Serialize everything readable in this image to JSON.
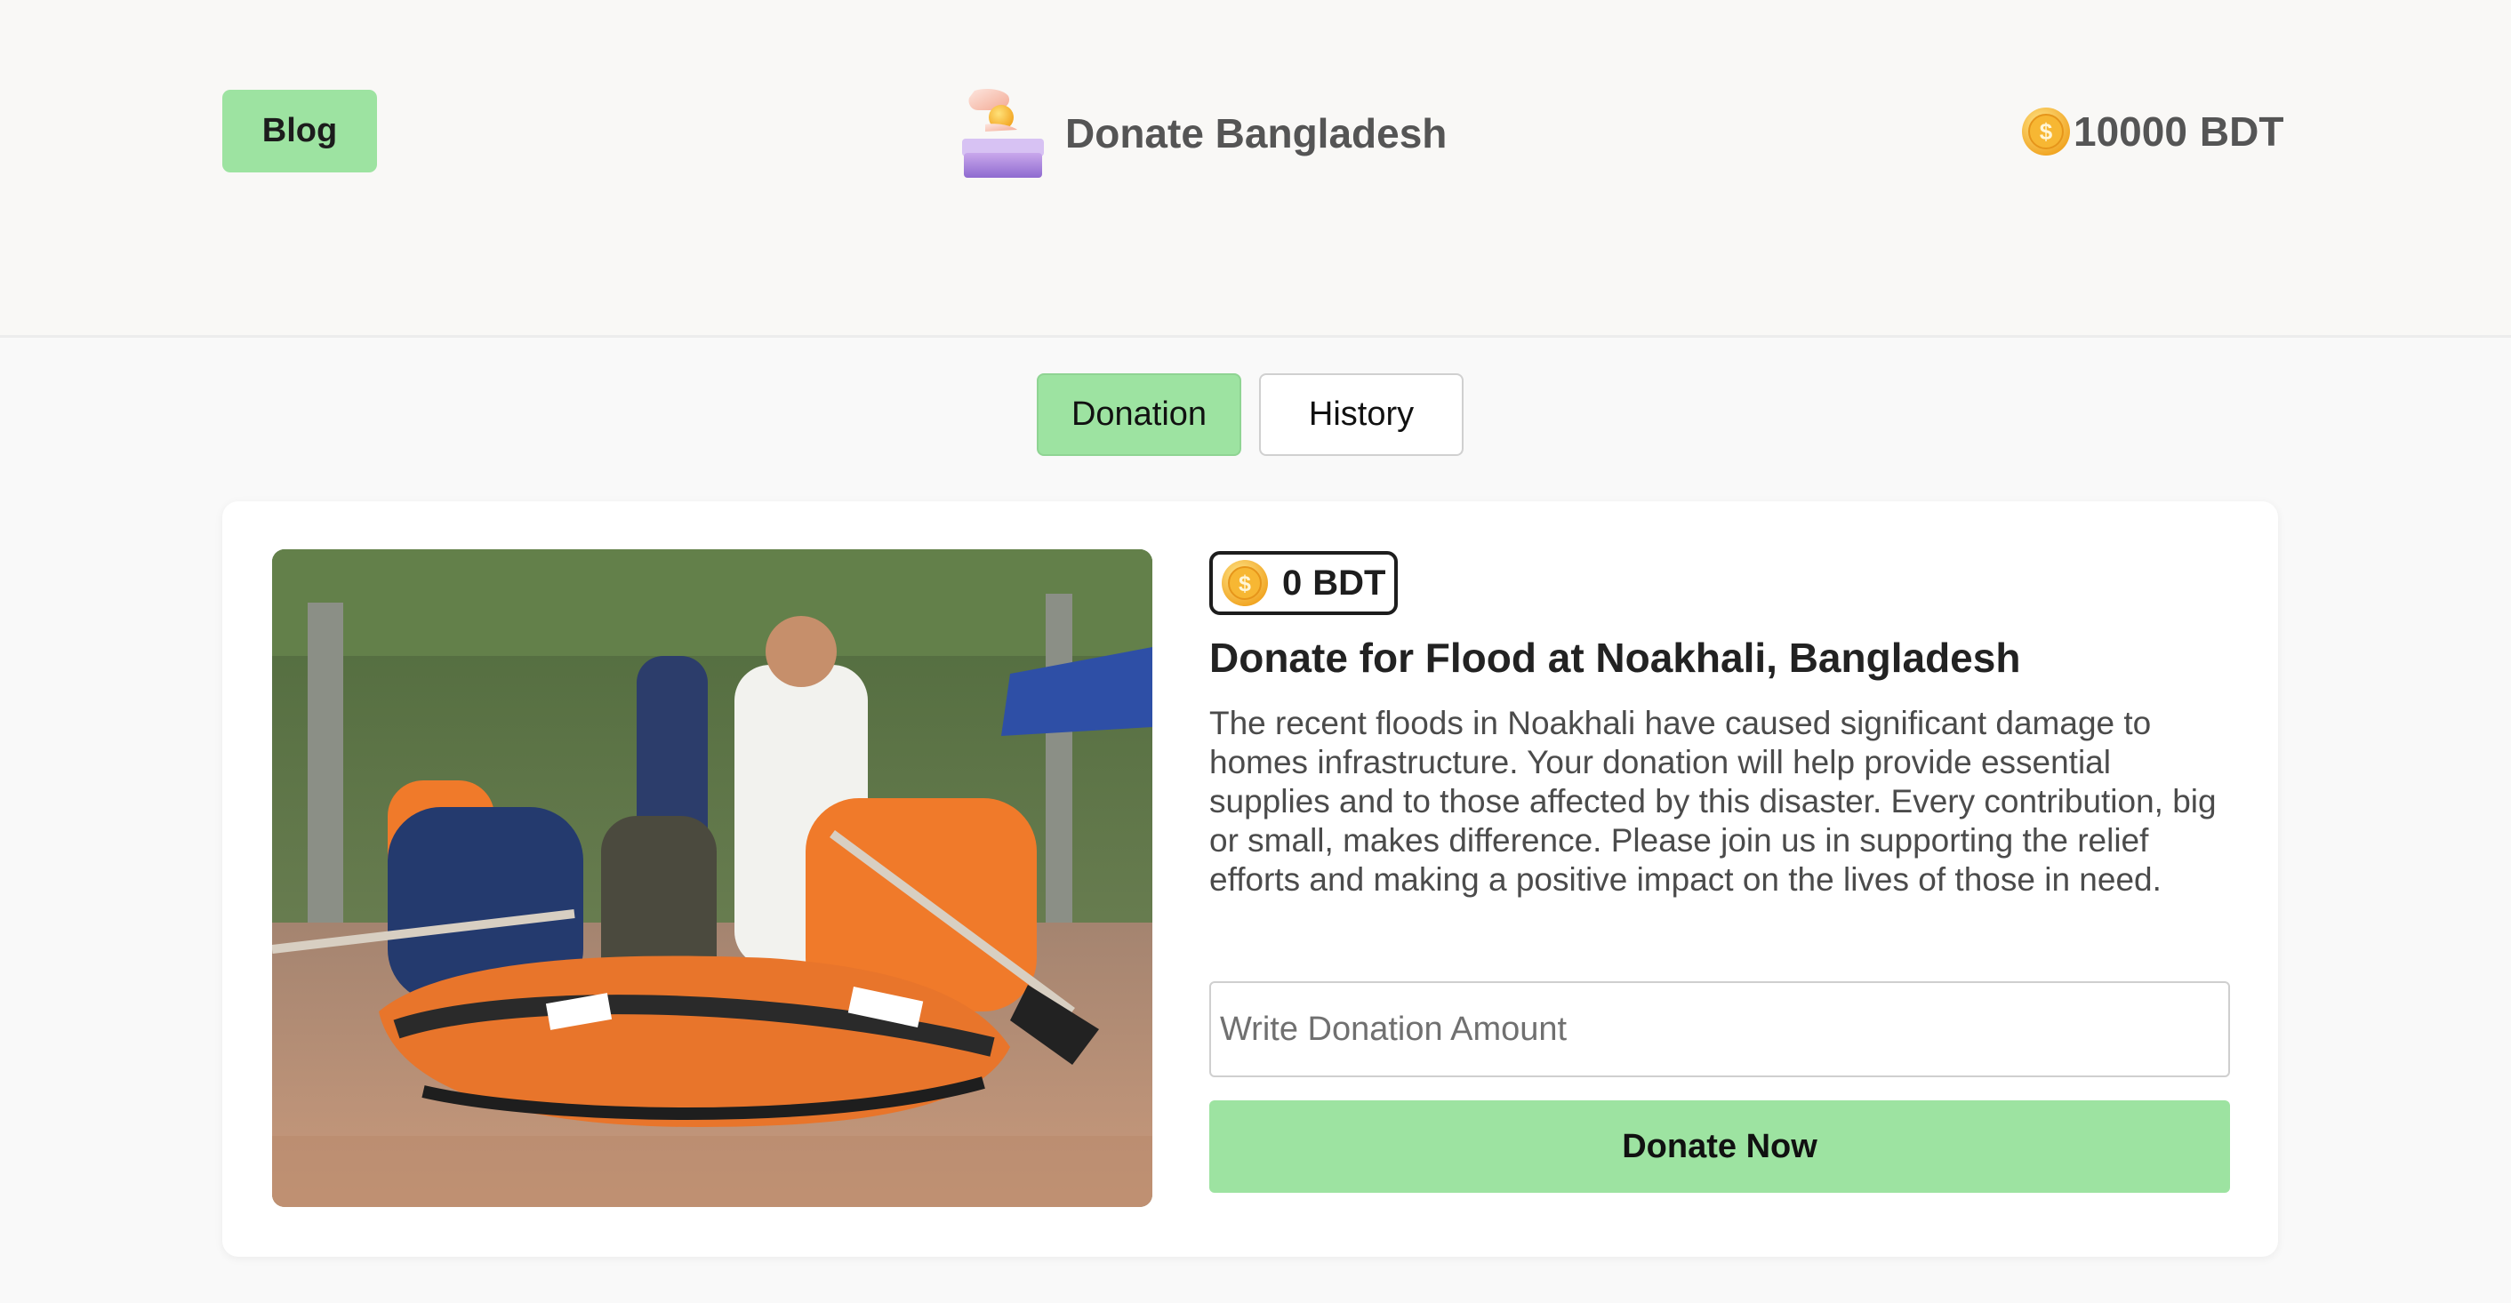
{
  "header": {
    "blog_label": "Blog",
    "brand_name": "Donate Bangladesh",
    "balance_amount": "10000",
    "balance_currency": "BDT",
    "logo_icon": "donation-hand-box-icon",
    "balance_icon": "coin-icon"
  },
  "tabs": [
    {
      "label": "Donation",
      "active": true
    },
    {
      "label": "History",
      "active": false
    }
  ],
  "card": {
    "donated_amount": "0",
    "donated_currency": "BDT",
    "title": "Donate for Flood at Noakhali, Bangladesh",
    "description": "The recent floods in Noakhali have caused significant damage to homes infrastructure. Your donation will help provide essential supplies and to those affected by this disaster. Every contribution, big or small, makes difference. Please join us in supporting the relief efforts and making a positive impact on the lives of those in need.",
    "input_placeholder": "Write Donation Amount",
    "input_value": "",
    "button_label": "Donate Now",
    "image_subject": "flood-rescue-boat-photo"
  },
  "colors": {
    "accent_green": "#9de3a1",
    "header_bg": "#f9f8f6",
    "page_bg": "#f9f9f9",
    "text_gray": "#555555"
  }
}
